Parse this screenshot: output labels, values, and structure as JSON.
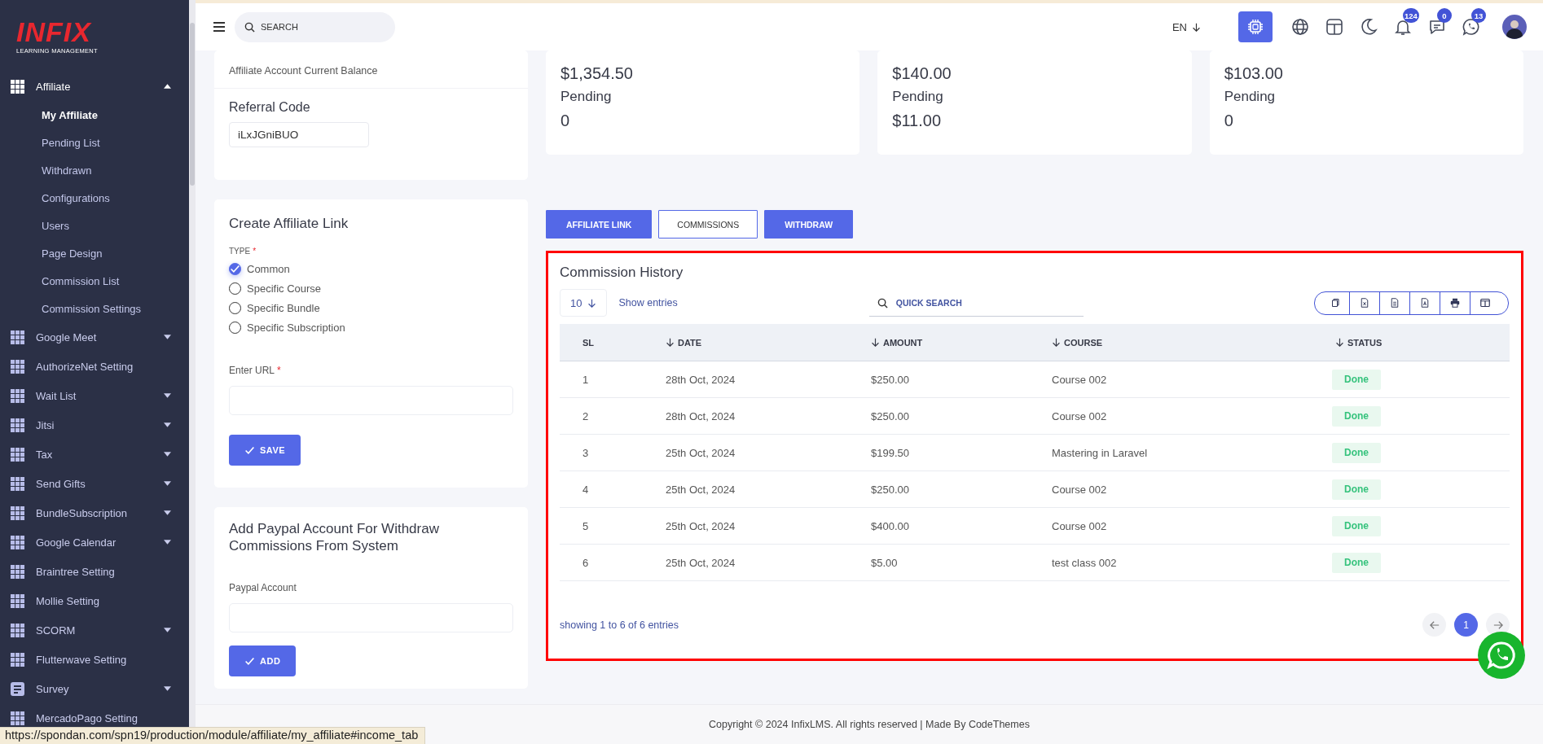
{
  "sidebar": {
    "logo": {
      "brand": "INFIX",
      "tagline": "LEARNING MANAGEMENT"
    },
    "items": [
      {
        "label": "Affiliate",
        "kind": "grid",
        "expanded": true,
        "children": [
          {
            "label": "My Affiliate",
            "selected": true
          },
          {
            "label": "Pending List",
            "selected": false
          },
          {
            "label": "Withdrawn",
            "selected": false
          },
          {
            "label": "Configurations",
            "selected": false
          },
          {
            "label": "Users",
            "selected": false
          },
          {
            "label": "Page Design",
            "selected": false
          },
          {
            "label": "Commission List",
            "selected": false
          },
          {
            "label": "Commission Settings",
            "selected": false
          }
        ]
      },
      {
        "label": "Google Meet",
        "kind": "grid",
        "expanded": false
      },
      {
        "label": "AuthorizeNet Setting",
        "kind": "grid"
      },
      {
        "label": "Wait List",
        "kind": "grid",
        "expanded": false
      },
      {
        "label": "Jitsi",
        "kind": "grid",
        "expanded": false
      },
      {
        "label": "Tax",
        "kind": "grid",
        "expanded": false
      },
      {
        "label": "Send Gifts",
        "kind": "grid",
        "expanded": false
      },
      {
        "label": "BundleSubscription",
        "kind": "grid",
        "expanded": false
      },
      {
        "label": "Google Calendar",
        "kind": "grid",
        "expanded": false
      },
      {
        "label": "Braintree Setting",
        "kind": "grid"
      },
      {
        "label": "Mollie Setting",
        "kind": "grid"
      },
      {
        "label": "SCORM",
        "kind": "grid",
        "expanded": false
      },
      {
        "label": "Flutterwave Setting",
        "kind": "grid"
      },
      {
        "label": "Survey",
        "kind": "form",
        "expanded": false
      },
      {
        "label": "MercadoPago Setting",
        "kind": "grid"
      }
    ]
  },
  "header": {
    "search": {
      "placeholder": "SEARCH"
    },
    "language": "EN",
    "icons": [
      {
        "kind": "ai"
      },
      {
        "kind": "globe"
      },
      {
        "kind": "layout"
      },
      {
        "kind": "moon"
      },
      {
        "kind": "bell",
        "badge": "124"
      },
      {
        "kind": "chat",
        "badge": "0"
      },
      {
        "kind": "whatsapp",
        "badge": "13"
      },
      {
        "kind": "avatar"
      }
    ]
  },
  "balance_card": {
    "subtitle": "Affiliate Account Current Balance",
    "referral_label": "Referral Code",
    "referral_code": "iLxJGniBUO"
  },
  "stat_cards": [
    {
      "amount": "$1,354.50",
      "pending_label": "Pending",
      "pending": "0"
    },
    {
      "amount": "$140.00",
      "pending_label": "Pending",
      "pending": "$11.00"
    },
    {
      "amount": "$103.00",
      "pending_label": "Pending",
      "pending": "0"
    }
  ],
  "affiliate_form": {
    "title": "Create Affiliate Link",
    "type_label": "TYPE",
    "required_mark": "*",
    "options": [
      {
        "label": "Common",
        "selected": true
      },
      {
        "label": "Specific Course",
        "selected": false
      },
      {
        "label": "Specific Bundle",
        "selected": false
      },
      {
        "label": "Specific Subscription",
        "selected": false
      }
    ],
    "url_label": "Enter URL",
    "url_required_mark": "*",
    "button": "SAVE"
  },
  "paypal_form": {
    "title": "Add Paypal Account For Withdraw Commissions From System",
    "field_label": "Paypal Account",
    "button": "ADD"
  },
  "tabs": [
    {
      "label": "AFFILIATE LINK",
      "selected": false
    },
    {
      "label": "COMMISSIONS",
      "selected": true
    },
    {
      "label": "WITHDRAW",
      "selected": false
    }
  ],
  "commission_table": {
    "title": "Commission History",
    "page_size": "10",
    "show_entries": "Show entries",
    "search": {
      "placeholder": "QUICK SEARCH"
    },
    "columns": [
      {
        "label": "SL",
        "sortable": false
      },
      {
        "label": "DATE",
        "sortable": true
      },
      {
        "label": "AMOUNT",
        "sortable": true
      },
      {
        "label": "COURSE",
        "sortable": true
      },
      {
        "label": "STATUS",
        "sortable": true
      }
    ],
    "rows": [
      {
        "sl": "1",
        "date": "28th Oct, 2024",
        "amount": "$250.00",
        "course": "Course 002",
        "status": "Done"
      },
      {
        "sl": "2",
        "date": "28th Oct, 2024",
        "amount": "$250.00",
        "course": "Course 002",
        "status": "Done"
      },
      {
        "sl": "3",
        "date": "25th Oct, 2024",
        "amount": "$199.50",
        "course": "Mastering in Laravel",
        "status": "Done"
      },
      {
        "sl": "4",
        "date": "25th Oct, 2024",
        "amount": "$250.00",
        "course": "Course 002",
        "status": "Done"
      },
      {
        "sl": "5",
        "date": "25th Oct, 2024",
        "amount": "$400.00",
        "course": "Course 002",
        "status": "Done"
      },
      {
        "sl": "6",
        "date": "25th Oct, 2024",
        "amount": "$5.00",
        "course": "test class 002",
        "status": "Done"
      }
    ],
    "summary": "showing 1 to 6 of 6 entries",
    "pages": [
      {
        "label": "1",
        "selected": true
      }
    ]
  },
  "footer": "Copyright © 2024 InfixLMS. All rights reserved | Made By CodeThemes",
  "status_url": "https://spondan.com/spn19/production/module/affiliate/my_affiliate#income_tab"
}
